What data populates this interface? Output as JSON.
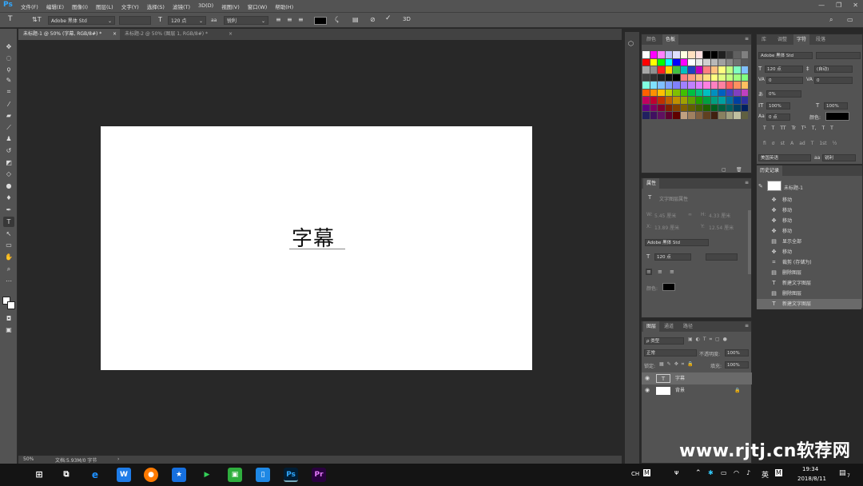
{
  "app": {
    "logo": "Ps"
  },
  "menu": [
    "文件(F)",
    "编辑(E)",
    "图像(I)",
    "图层(L)",
    "文字(Y)",
    "选择(S)",
    "滤镜(T)",
    "3D(D)",
    "视图(V)",
    "窗口(W)",
    "帮助(H)"
  ],
  "window_controls": {
    "minimize": "—",
    "restore": "❐",
    "close": "✕"
  },
  "options": {
    "font_family": "Adobe 黑体 Std",
    "font_style": "",
    "font_size": "120 点",
    "aa_label": "aa",
    "anti_alias": "锐利",
    "text_color": "#000000"
  },
  "doc_tabs": [
    {
      "label": "未标题-1 @ 50% (字幕, RGB/8#) *",
      "close": "×"
    },
    {
      "label": "未标题-2 @ 50% (图层 1, RGB/8#) *",
      "close": "×"
    }
  ],
  "canvas": {
    "text": "字幕"
  },
  "status": {
    "zoom": "50%",
    "doc": "文档:5.93M/0 字节",
    "arrow": "›"
  },
  "swatches_panel": {
    "tabs": [
      "颜色",
      "色板"
    ]
  },
  "swatch_colors": [
    "#ffffff",
    "#ff00ff",
    "#ff80ff",
    "#c0c0ff",
    "#e0e0ff",
    "#ffffe0",
    "#ffe0c0",
    "#ffe0e0",
    "#000000",
    "#000000",
    "#202020",
    "#404040",
    "#606060",
    "#808080",
    "#ff0000",
    "#ffff00",
    "#00ff00",
    "#00ffff",
    "#0000ff",
    "#ff00ff",
    "#ffffff",
    "#e8e8e8",
    "#d0d0d0",
    "#b8b8b8",
    "#a0a0a0",
    "#888888",
    "#707070",
    "#585858",
    "#a8a8a8",
    "#909090",
    "#ff2020",
    "#ffd000",
    "#40c040",
    "#00c0c0",
    "#2040c0",
    "#c000c0",
    "#ff8080",
    "#ffc080",
    "#ffff80",
    "#c0ff80",
    "#80ffc0",
    "#80c0ff",
    "#404040",
    "#303030",
    "#202020",
    "#101010",
    "#000000",
    "#ff8080",
    "#ffa080",
    "#ffc080",
    "#ffe080",
    "#ffff80",
    "#e0ff80",
    "#c0ff80",
    "#a0ff80",
    "#80ff80",
    "#80ffe0",
    "#80e0ff",
    "#80c0ff",
    "#80a0ff",
    "#8080ff",
    "#a080ff",
    "#c080ff",
    "#e080ff",
    "#ff80e0",
    "#ff80c0",
    "#ff80a0",
    "#ff6060",
    "#ff9060",
    "#ffc060",
    "#ff6000",
    "#ff9000",
    "#ffc000",
    "#c0d000",
    "#80c000",
    "#40c000",
    "#00c040",
    "#00c080",
    "#00c0c0",
    "#0090c0",
    "#0060c0",
    "#4040c0",
    "#8040c0",
    "#c040c0",
    "#c00060",
    "#c00030",
    "#c03000",
    "#c06000",
    "#c09000",
    "#a0a000",
    "#60a000",
    "#20a000",
    "#00a040",
    "#00a080",
    "#00a0a0",
    "#0070a0",
    "#0040a0",
    "#3030a0",
    "#600080",
    "#800060",
    "#800030",
    "#802000",
    "#804000",
    "#806000",
    "#606000",
    "#406000",
    "#206000",
    "#006020",
    "#006040",
    "#006060",
    "#004060",
    "#002060",
    "#202060",
    "#401060",
    "#601060",
    "#600030",
    "#600000",
    "#c0a080",
    "#a08060",
    "#806040",
    "#604020",
    "#402010",
    "#888060",
    "#a0a080",
    "#c0c0a0",
    "#606040"
  ],
  "character_panel": {
    "tabs": [
      "库",
      "调整",
      "字符",
      "段落"
    ],
    "font_family": "Adobe 黑体 Std",
    "font_style": "",
    "size": "120 点",
    "leading": "(自动)",
    "kerning": "0",
    "tracking": "0",
    "scale_label": "0%",
    "vscale": "100%",
    "hscale": "100%",
    "baseline": "0 点",
    "color_label": "颜色:",
    "color": "#000000",
    "styles": [
      "T",
      "T",
      "TT",
      "Tr",
      "T¹",
      "T,",
      "T",
      "T"
    ],
    "opentype": [
      "fi",
      "σ",
      "st",
      "A",
      "ad",
      "T",
      "1st",
      "½"
    ],
    "language": "美国英语",
    "aa": "锐利",
    "aa_label": "aa"
  },
  "properties_panel": {
    "tab": "属性",
    "subtitle": "文字图层属性",
    "w_label": "W:",
    "w_value": "5.45 厘米",
    "h_label": "H:",
    "h_value": "4.33 厘米",
    "x_label": "X:",
    "x_value": "13.89 厘米",
    "y_label": "Y:",
    "y_value": "12.54 厘米",
    "font_family": "Adobe 黑体 Std",
    "size": "120 点",
    "color_label": "颜色:",
    "color": "#000000"
  },
  "history_panel": {
    "tab": "历史记录",
    "snapshot": "未标题-1",
    "items": [
      {
        "icon": "move-icon",
        "glyph": "✥",
        "label": "移动"
      },
      {
        "icon": "move-icon",
        "glyph": "✥",
        "label": "移动"
      },
      {
        "icon": "move-icon",
        "glyph": "✥",
        "label": "移动"
      },
      {
        "icon": "move-icon",
        "glyph": "✥",
        "label": "移动"
      },
      {
        "icon": "document-icon",
        "glyph": "▤",
        "label": "显示全部"
      },
      {
        "icon": "move-icon",
        "glyph": "✥",
        "label": "移动"
      },
      {
        "icon": "crop-icon",
        "glyph": "⌗",
        "label": "裁剪 (存储为)"
      },
      {
        "icon": "document-icon",
        "glyph": "▤",
        "label": "删除图层"
      },
      {
        "icon": "type-icon",
        "glyph": "T",
        "label": "新建文字图层"
      },
      {
        "icon": "document-icon",
        "glyph": "▤",
        "label": "删除图层"
      },
      {
        "icon": "type-icon",
        "glyph": "T",
        "label": "新建文字图层"
      }
    ]
  },
  "layers_panel": {
    "tabs": [
      "图层",
      "通道",
      "路径"
    ],
    "filter": "ρ 类型",
    "blend": "正常",
    "opacity_label": "不透明度:",
    "opacity": "100%",
    "lock_label": "锁定:",
    "fill_label": "填充:",
    "fill": "100%",
    "layers": [
      {
        "name": "字幕",
        "type": "T",
        "selected": true
      },
      {
        "name": "背景",
        "type": "bg",
        "selected": false
      }
    ]
  },
  "watermark": "www.rjtj.cn软荐网",
  "taskbar": {
    "ime": "CH",
    "lang": "英",
    "time": "19:34",
    "date": "2018/8/11",
    "notif": "7",
    "apps": [
      "W",
      "Ps",
      "Pr"
    ]
  }
}
